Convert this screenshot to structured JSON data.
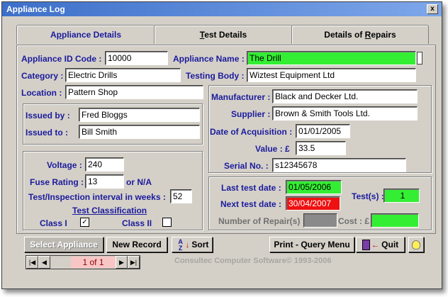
{
  "window": {
    "title": "Appliance Log",
    "close_glyph": "x"
  },
  "tabs": [
    {
      "pre": "A",
      "u": "p",
      "post": "pliance Details"
    },
    {
      "pre": "",
      "u": "T",
      "post": "est Details"
    },
    {
      "pre": "Details of ",
      "u": "R",
      "post": "epairs"
    }
  ],
  "appliance": {
    "id_label": "Appliance ID Code :",
    "id_value": "10000",
    "name_label": "Appliance Name :",
    "name_value": "The Drill",
    "category_label": "Category :",
    "category_value": "Electric Drills",
    "testing_body_label": "Testing Body :",
    "testing_body_value": "Wiztest Equipment Ltd",
    "location_label": "Location :",
    "location_value": "Pattern Shop"
  },
  "issue": {
    "issued_by_label": "Issued by :",
    "issued_by_value": "Fred Bloggs",
    "issued_to_label": "Issued to :",
    "issued_to_value": "Bill Smith"
  },
  "electrical": {
    "voltage_label": "Voltage :",
    "voltage_value": "240",
    "fuse_label": "Fuse Rating :",
    "fuse_value": "13",
    "fuse_suffix": "or N/A",
    "interval_label": "Test/Inspection interval in weeks :",
    "interval_value": "52",
    "classification_label": "Test Classification",
    "class1_label": "Class I",
    "class1_checked": "✓",
    "class2_label": "Class II",
    "class2_checked": ""
  },
  "supplier": {
    "manufacturer_label": "Manufacturer :",
    "manufacturer_value": "Black and Decker Ltd.",
    "supplier_label": "Supplier :",
    "supplier_value": "Brown & Smith Tools Ltd.",
    "acq_label": "Date of Acquisition :",
    "acq_value": "01/01/2005",
    "value_label": "Value : £",
    "value_value": "33.5",
    "serial_label": "Serial No. :",
    "serial_value": "s12345678"
  },
  "test": {
    "last_label": "Last test date :",
    "last_value": "01/05/2006",
    "next_label": "Next test date :",
    "next_value": "30/04/2007",
    "tests_label": "Test(s) :",
    "tests_value": "1",
    "repairs_label": "Number of Repair(s) :",
    "repairs_value": "",
    "cost_label": "Cost : £",
    "cost_value": ""
  },
  "colors": {
    "green": "#33ee33",
    "red": "#ee1111",
    "gray_field": "#8a8a8a",
    "label_blue": "#1b1b9c"
  },
  "buttons": {
    "select": "Select Appliance",
    "new_record": "New Record",
    "sort": "Sort",
    "print": "Print - Query Menu",
    "quit": "Quit"
  },
  "icons": {
    "sort": "sort-az-icon",
    "quit": "exit-door-icon",
    "help": "lightbulb-icon"
  },
  "navigator": {
    "position": "1 of 1"
  },
  "footer": "Consultec Computer Software© 1993-2006"
}
